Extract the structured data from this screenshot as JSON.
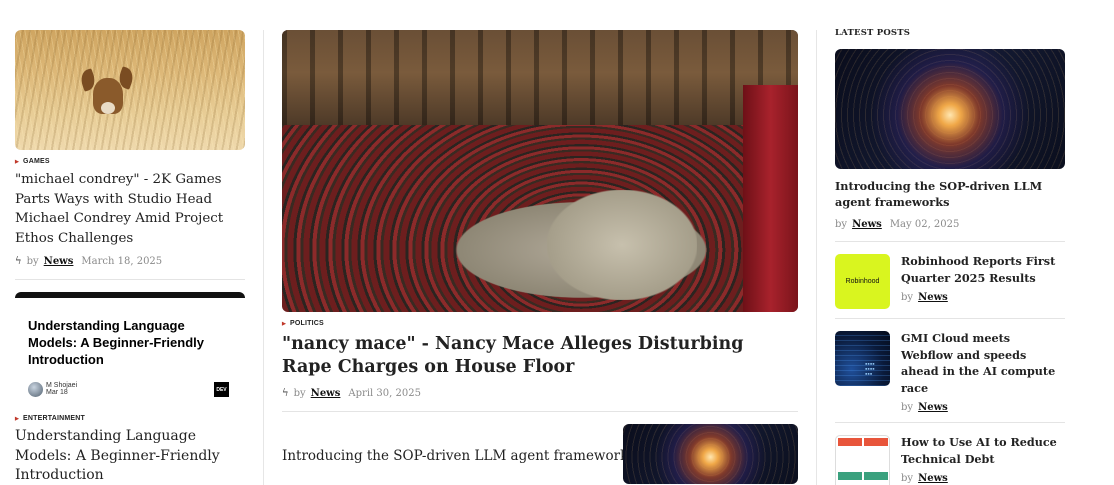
{
  "left": {
    "article1": {
      "category": "GAMES",
      "title": "\"michael condrey\" - 2K Games Parts Ways with Studio Head Michael Condrey Amid Project Ethos Challenges",
      "by": "by",
      "author": "News",
      "date": "March 18, 2025"
    },
    "devcard": {
      "title": "Understanding Language Models: A Beginner-Friendly Introduction",
      "author_name": "M Shojaei",
      "author_sub": "Mar 18",
      "logo": "DEV"
    },
    "article2": {
      "category": "ENTERTAINMENT",
      "title": "Understanding Language Models: A Beginner-Friendly Introduction"
    }
  },
  "main": {
    "category": "POLITICS",
    "title": "\"nancy mace\" - Nancy Mace Alleges Disturbing Rape Charges on House Floor",
    "by": "by",
    "author": "News",
    "date": "April 30, 2025",
    "second_title": "Introducing the SOP-driven LLM agent frameworks"
  },
  "sidebar": {
    "heading": "LATEST POSTS",
    "featured": {
      "title": "Introducing the SOP-driven LLM agent frameworks",
      "by": "by",
      "author": "News",
      "date": "May 02, 2025"
    },
    "posts": [
      {
        "title": "Robinhood Reports First Quarter 2025 Results",
        "by": "by",
        "author": "News",
        "thumb_label": "Robinhood"
      },
      {
        "title": "GMI Cloud meets Webflow and speeds ahead in the AI compute race",
        "by": "by",
        "author": "News"
      },
      {
        "title": "How to Use AI to Reduce Technical Debt",
        "by": "by",
        "author": "News"
      }
    ]
  },
  "colors": {
    "accent_red": "#c0392b",
    "robinhood_green": "#d9f51f"
  }
}
